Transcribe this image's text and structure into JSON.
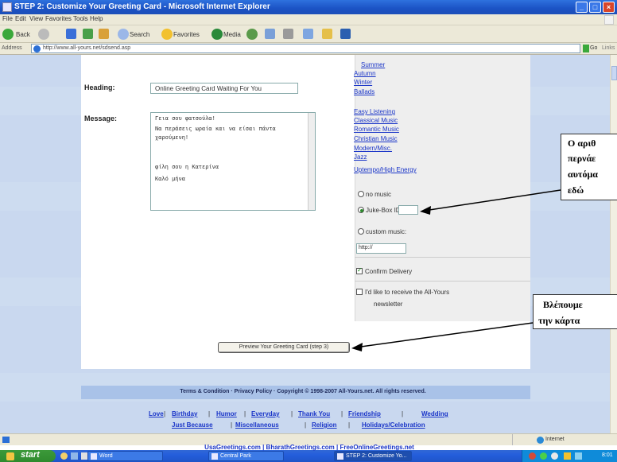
{
  "window": {
    "title": "STEP 2: Customize Your Greeting Card - Microsoft Internet Explorer",
    "controls": [
      "_",
      "□",
      "×"
    ]
  },
  "menu": [
    "File",
    "Edit",
    "View",
    "Favorites",
    "Tools",
    "Help"
  ],
  "toolbar": {
    "back": "Back",
    "search": "Search",
    "favorites": "Favorites",
    "media": "Media"
  },
  "address": {
    "label": "Address",
    "url": "http://www.all-yours.net/sdsend.asp",
    "go": "Go",
    "links": "Links"
  },
  "form": {
    "heading_label": "Heading:",
    "heading_value": "Online Greeting Card Waiting For You",
    "message_label": "Message:",
    "message_lines": [
      "Γεια σου φατσούλα!",
      "Να περάσεις ωραία και να είσαι πάντα χαρούμενη!",
      "φίλη σου η Κατερίνα",
      "Καλό μήνα"
    ],
    "preview_button": "Preview Your Greeting Card (step 3)"
  },
  "music": {
    "categories": [
      "Summer",
      "Autumn",
      "Winter",
      "Ballads",
      "Easy Listening",
      "Classical Music",
      "Romantic Music",
      "Christian Music",
      "Modern/Misc.",
      "Jazz",
      "Uptempo/High Energy"
    ],
    "no_music": "no music",
    "jukebox_label": "Juke-Box ID:",
    "selected_option": "Juke-Box ID:",
    "custom_label": "custom music:",
    "custom_value": "http://"
  },
  "options": {
    "confirm_delivery": "Confirm Delivery",
    "confirm_checked": true,
    "newsletter_line1": "I'd like to receive the All-Yours",
    "newsletter_line2": "newsletter",
    "newsletter_checked": false
  },
  "annotations": {
    "top": [
      "Ο αριθ",
      "περνάε",
      "αυτόμα",
      "εδώ"
    ],
    "bottom": [
      "Βλέπουμε",
      "την κάρτα"
    ]
  },
  "footer": {
    "copyright": "Terms & Condition · Privacy Policy · Copyright © 1998-2007 All-Yours.net. All rights reserved.",
    "links_row1": [
      "Love",
      "Birthday",
      "Humor",
      "Everyday",
      "Thank You",
      "Friendship",
      "Wedding"
    ],
    "links_row2": [
      "Just Because",
      "Miscellaneous",
      "Religion",
      "Holidays/Celebration"
    ],
    "partners": "UsaGreetings.com | BharathGreetings.com | FreeOnlineGreetings.net"
  },
  "status": {
    "zone": "Internet"
  },
  "taskbar": {
    "start": "start",
    "tasks": [
      "Word",
      "Central Park",
      "STEP 2: Customize Yo..."
    ],
    "clock": "8:01"
  },
  "colors": {
    "title_blue": "#1b52c4",
    "page_bg": "#c9d8ef",
    "link": "#1a35c8",
    "start_green": "#2f8a2e"
  }
}
